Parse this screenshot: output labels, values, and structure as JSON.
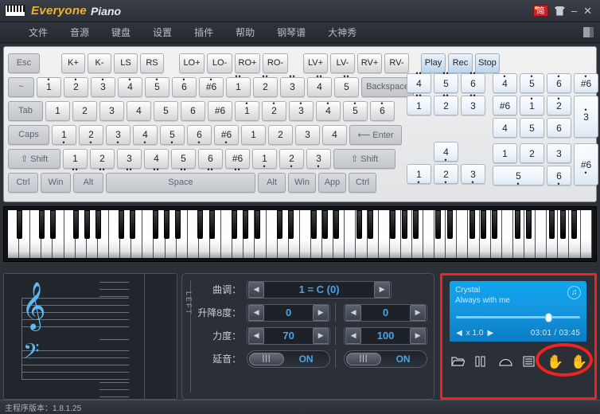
{
  "titlebar": {
    "app_name": "Everyone",
    "app_sub": "Piano",
    "lang_badge": "简",
    "skin_icon": "shirt-icon",
    "minimize": "–",
    "close": "✕"
  },
  "menubar": {
    "items": [
      {
        "label": "文件"
      },
      {
        "label": "音源"
      },
      {
        "label": "键盘"
      },
      {
        "label": "设置"
      },
      {
        "label": "插件"
      },
      {
        "label": "帮助"
      },
      {
        "label": "钢琴谱"
      },
      {
        "label": "大神秀"
      }
    ]
  },
  "keyboard": {
    "row_fn": {
      "esc": "Esc",
      "group1": [
        "K+",
        "K-",
        "LS",
        "RS"
      ],
      "group2": [
        "LO+",
        "LO-",
        "RO+",
        "RO-"
      ],
      "group3": [
        "LV+",
        "LV-",
        "RV+",
        "RV-"
      ],
      "transport": [
        "Play",
        "Rec",
        "Stop"
      ]
    },
    "row_num": {
      "first": "~",
      "keys": [
        {
          "d": "1",
          "dots": "up1"
        },
        {
          "d": "2",
          "dots": "up1"
        },
        {
          "d": "3",
          "dots": "up1"
        },
        {
          "d": "4",
          "dots": "up1"
        },
        {
          "d": "5",
          "dots": "up1"
        },
        {
          "d": "6",
          "dots": "up1"
        },
        {
          "d": "#6",
          "dots": "up1"
        },
        {
          "d": "1",
          "dots": "up2"
        },
        {
          "d": "2",
          "dots": "up2"
        },
        {
          "d": "3",
          "dots": "up2"
        },
        {
          "d": "4",
          "dots": "up2"
        },
        {
          "d": "5",
          "dots": "up2"
        }
      ],
      "last": "Backspace"
    },
    "row_tab": {
      "first": "Tab",
      "keys": [
        {
          "d": "1",
          "dots": ""
        },
        {
          "d": "2",
          "dots": ""
        },
        {
          "d": "3",
          "dots": ""
        },
        {
          "d": "4",
          "dots": ""
        },
        {
          "d": "5",
          "dots": ""
        },
        {
          "d": "6",
          "dots": ""
        },
        {
          "d": "#6",
          "dots": ""
        },
        {
          "d": "1",
          "dots": "up1"
        },
        {
          "d": "2",
          "dots": "up1"
        },
        {
          "d": "3",
          "dots": "up1"
        },
        {
          "d": "4",
          "dots": "up1"
        },
        {
          "d": "5",
          "dots": "up1"
        },
        {
          "d": "6",
          "dots": "up1"
        }
      ]
    },
    "row_caps": {
      "first": "Caps",
      "keys": [
        {
          "d": "1",
          "dots": "dn1"
        },
        {
          "d": "2",
          "dots": "dn1"
        },
        {
          "d": "3",
          "dots": "dn1"
        },
        {
          "d": "4",
          "dots": "dn1"
        },
        {
          "d": "5",
          "dots": "dn1"
        },
        {
          "d": "6",
          "dots": "dn1"
        },
        {
          "d": "#6",
          "dots": "dn1"
        },
        {
          "d": "1",
          "dots": ""
        },
        {
          "d": "2",
          "dots": ""
        },
        {
          "d": "3",
          "dots": ""
        },
        {
          "d": "4",
          "dots": ""
        }
      ],
      "last": "⟵ Enter"
    },
    "row_shift": {
      "first": "⇧ Shift",
      "keys": [
        {
          "d": "1",
          "dots": "dn2"
        },
        {
          "d": "2",
          "dots": "dn2"
        },
        {
          "d": "3",
          "dots": "dn2"
        },
        {
          "d": "4",
          "dots": "dn2"
        },
        {
          "d": "5",
          "dots": "dn2"
        },
        {
          "d": "6",
          "dots": "dn2"
        },
        {
          "d": "#6",
          "dots": "dn2"
        },
        {
          "d": "1",
          "dots": "dn1"
        },
        {
          "d": "2",
          "dots": "dn1"
        },
        {
          "d": "3",
          "dots": "dn1"
        }
      ],
      "last": "⇧ Shift"
    },
    "row_space": {
      "left": [
        "Ctrl",
        "Win",
        "Alt"
      ],
      "space": "Space",
      "right": [
        "Alt",
        "Win",
        "App",
        "Ctrl"
      ]
    },
    "arrow_cluster": {
      "r1": [
        {
          "d": "4",
          "dots": "up2"
        },
        {
          "d": "5",
          "dots": "up2"
        },
        {
          "d": "6",
          "dots": "up2"
        }
      ],
      "r2": [
        {
          "d": "1",
          "dots": "up2"
        },
        {
          "d": "2",
          "dots": "up2"
        },
        {
          "d": "3",
          "dots": "up2"
        }
      ],
      "r3": [
        {
          "d": "4",
          "dots": "dn1"
        }
      ],
      "r4": [
        {
          "d": "1",
          "dots": "dn1"
        },
        {
          "d": "2",
          "dots": "dn1"
        },
        {
          "d": "3",
          "dots": "dn1"
        }
      ]
    },
    "numpad": {
      "r1": [
        {
          "d": "4",
          "dots": "up1"
        },
        {
          "d": "5",
          "dots": "up1"
        },
        {
          "d": "6",
          "dots": "up1"
        },
        {
          "d": "#6",
          "dots": "up1"
        }
      ],
      "r2": [
        {
          "d": "#6",
          "dots": ""
        },
        {
          "d": "1",
          "dots": "up1"
        },
        {
          "d": "2",
          "dots": "up1"
        }
      ],
      "r3": [
        {
          "d": "4",
          "dots": ""
        },
        {
          "d": "5",
          "dots": ""
        },
        {
          "d": "6",
          "dots": ""
        }
      ],
      "tall1": {
        "d": "3",
        "dots": "up1"
      },
      "r4": [
        {
          "d": "1",
          "dots": ""
        },
        {
          "d": "2",
          "dots": ""
        },
        {
          "d": "3",
          "dots": ""
        }
      ],
      "r5": [
        {
          "d": "5",
          "dots": "dn1"
        },
        {
          "d": "6",
          "dots": "dn1"
        }
      ],
      "tall2": {
        "d": "#6",
        "dots": "dn1"
      }
    }
  },
  "controls": {
    "side_label": "LEFT",
    "tune_label": "曲调：",
    "tune_value": "1 = C (0)",
    "octave_label": "升降8度：",
    "octave_left": "0",
    "octave_right": "0",
    "velocity_label": "力度：",
    "velocity_left": "70",
    "velocity_right": "100",
    "sustain_label": "延音：",
    "sustain_left": "ON",
    "sustain_right": "ON",
    "arrow_left": "◀",
    "arrow_right": "▶"
  },
  "player": {
    "track_artist": "Crystal",
    "track_title": "Always with me",
    "speed": "x 1.0",
    "speed_prev": "◀",
    "speed_next": "▶",
    "time": "03:01 / 03:45",
    "note_icon": "music-note-icon",
    "buttons": [
      {
        "name": "open-folder-icon"
      },
      {
        "name": "pause-icon"
      },
      {
        "name": "arc-icon"
      },
      {
        "name": "score-list-icon"
      },
      {
        "name": "left-hand-icon",
        "glyph": "✋",
        "color": "#8ede2a"
      },
      {
        "name": "right-hand-icon",
        "glyph": "✋",
        "color": "#4da8e8"
      }
    ]
  },
  "status": {
    "version_text": "主程序版本：1.8.1.25"
  },
  "colors": {
    "accent_blue": "#4ba3e3",
    "brand_gold": "#f0b429",
    "highlight_red": "#ef2420",
    "lcd_blue": "#0fa5f0"
  }
}
